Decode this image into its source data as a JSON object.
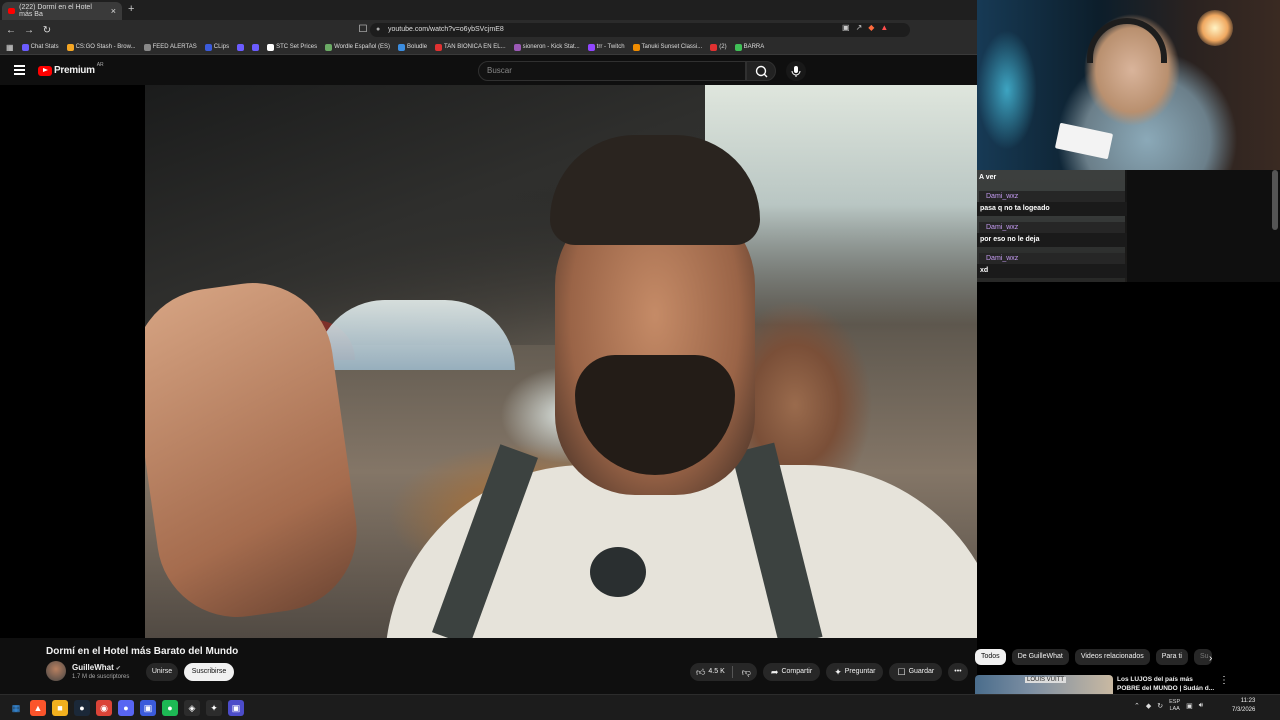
{
  "browser": {
    "tab_title": "(222) Dormí en el Hotel más Ba",
    "tab_close": "×",
    "new_tab": "+",
    "url": "youtube.com/watch?v=o6ybSVcjmE8",
    "bookmarks": [
      {
        "label": "Chat Stats",
        "color": "#6b5cff"
      },
      {
        "label": "CS:GO Stash - Brow...",
        "color": "#f5a623"
      },
      {
        "label": "FEED ALERTAS",
        "color": "#888888"
      },
      {
        "label": "CLips",
        "color": "#3b5bdb"
      },
      {
        "label": "",
        "color": "#6b5cff"
      },
      {
        "label": "",
        "color": "#6b5cff"
      },
      {
        "label": "STC Set Prices",
        "color": "#ffffff"
      },
      {
        "label": "Wordle Español (ES)",
        "color": "#6aaa64"
      },
      {
        "label": "Boludle",
        "color": "#3b8de0"
      },
      {
        "label": "TAN BIONICA EN EL...",
        "color": "#e03131"
      },
      {
        "label": "sioneron - Kick Stat...",
        "color": "#9b59b6"
      },
      {
        "label": "trr - Twitch",
        "color": "#9146ff"
      },
      {
        "label": "Tanuki Sunset Classi...",
        "color": "#f08c00"
      },
      {
        "label": "(2)",
        "color": "#e03131"
      },
      {
        "label": "BARRA",
        "color": "#40c057"
      }
    ]
  },
  "youtube": {
    "logo_text": "Premium",
    "logo_country": "AR",
    "search_placeholder": "Buscar",
    "video_title": "Dormí en el Hotel más Barato del Mundo",
    "channel_name": "GuilleWhat",
    "subscribers": "1.7 M de suscriptores",
    "join_label": "Unirse",
    "subscribe_label": "Suscribirse",
    "likes": "4.5 K",
    "share_label": "Compartir",
    "ask_label": "Preguntar",
    "save_label": "Guardar",
    "more_label": "•••",
    "chips": [
      "Todos",
      "De GuilleWhat",
      "Videos relacionados",
      "Para ti",
      "Su"
    ],
    "recommended_title": "Los LUJOS del país más POBRE del MUNDO | Sudán d...",
    "recommended_thumb_sign": "LOUIS VUITT"
  },
  "chat": {
    "first_line": "A ver",
    "messages": [
      {
        "user": "Dami_wxz",
        "text": "pasa q no ta logeado"
      },
      {
        "user": "Dami_wxz",
        "text": "por eso no le deja"
      },
      {
        "user": "Dami_wxz",
        "text": "xd"
      }
    ]
  },
  "taskbar": {
    "lang_top": "ESP",
    "lang_bottom": "LAA",
    "time": "11:23",
    "date": "7/3/2026"
  }
}
